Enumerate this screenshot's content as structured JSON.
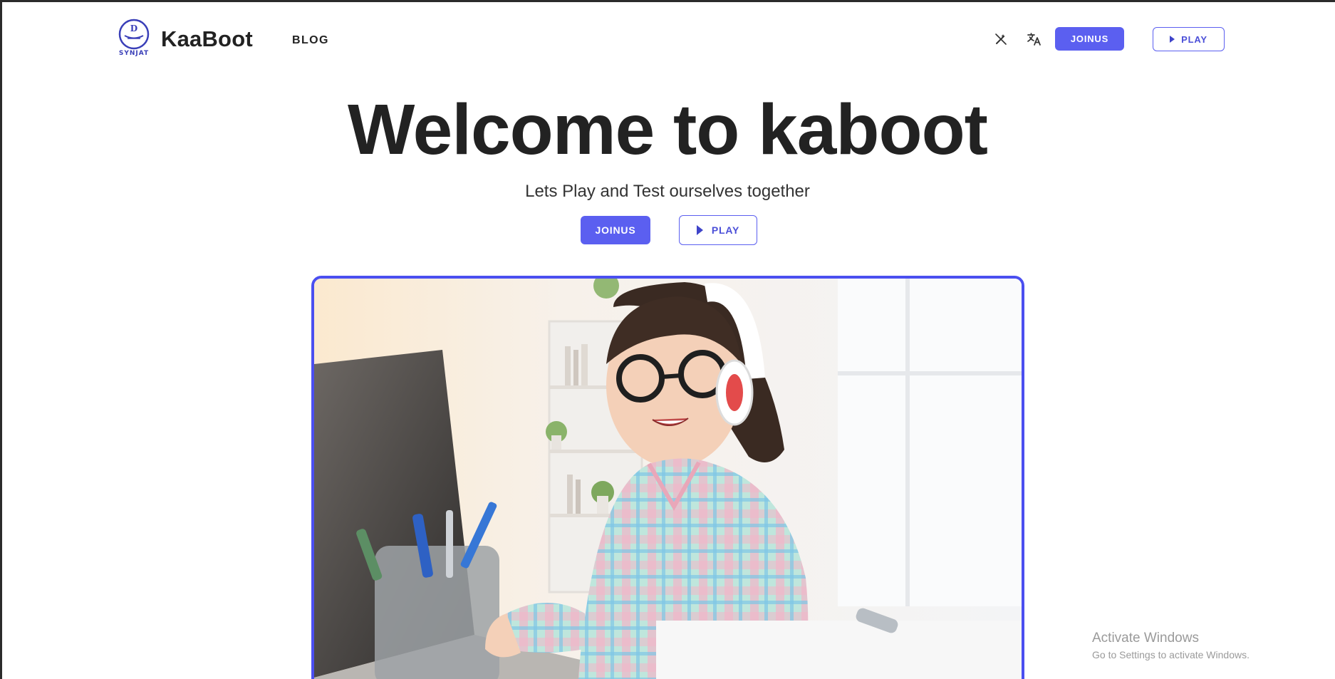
{
  "header": {
    "brand": "KaaBoot",
    "logo_text": "SYNJAT",
    "nav_blog": "BLOG",
    "theme_icon": "magic-wand-off-icon",
    "translate_icon": "translate-icon",
    "join_label": "JOINUS",
    "play_label": "PLAY"
  },
  "hero": {
    "title": "Welcome to kaboot",
    "subtitle": "Lets Play and Test ourselves together",
    "join_label": "JOINUS",
    "play_label": "PLAY"
  },
  "colors": {
    "accent": "#5b5ff0",
    "photo_border": "#4b4ff0",
    "text": "#222222"
  },
  "watermark": {
    "line1": "Activate Windows",
    "line2": "Go to Settings to activate Windows."
  }
}
